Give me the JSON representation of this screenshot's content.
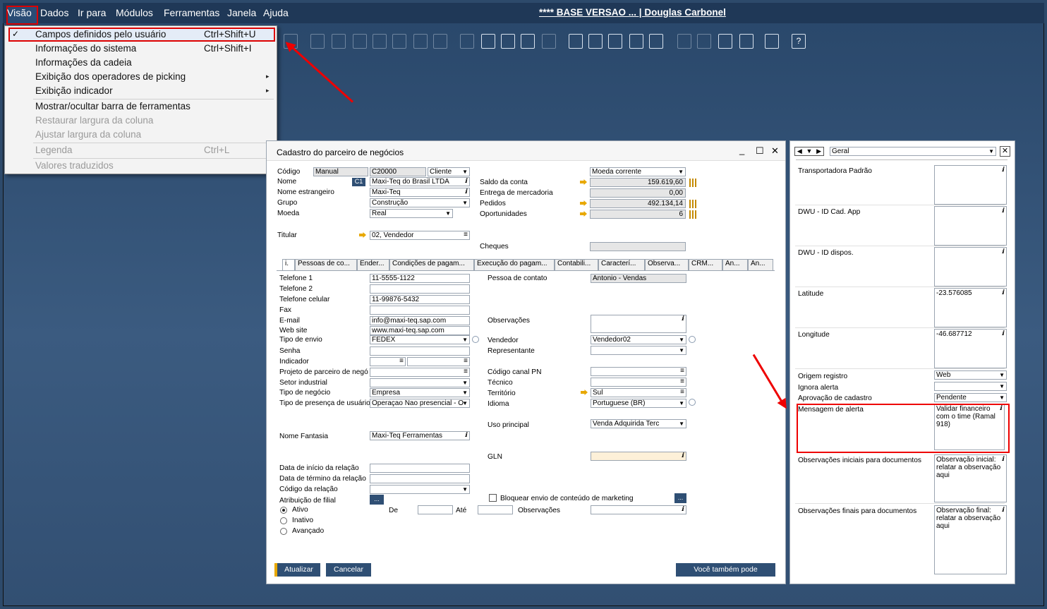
{
  "menubar": {
    "items": [
      "Visão",
      "Dados",
      "Ir para",
      "Módulos",
      "Ferramentas",
      "Janela",
      "Ajuda"
    ],
    "title": "**** BASE VERSAO ... | Douglas Carbonel"
  },
  "menu": {
    "items": [
      {
        "label": "Campos definidos pelo usuário",
        "shortcut": "Ctrl+Shift+U",
        "checked": true
      },
      {
        "label": "Informações do sistema",
        "shortcut": "Ctrl+Shift+I"
      },
      {
        "label": "Informações da cadeia",
        "shortcut": ""
      },
      {
        "label": "Exibição dos operadores de picking",
        "shortcut": ""
      },
      {
        "label": "Exibição indicador",
        "shortcut": ""
      },
      {
        "label": "Mostrar/ocultar barra de ferramentas",
        "shortcut": ""
      },
      {
        "label": "Restaurar largura da coluna",
        "shortcut": ""
      },
      {
        "label": "Ajustar largura da coluna",
        "shortcut": ""
      },
      {
        "label": "Legenda",
        "shortcut": "Ctrl+L"
      },
      {
        "label": "Valores traduzidos",
        "shortcut": ""
      }
    ],
    "checkmark": "✓",
    "submenu_arrow": "▸"
  },
  "form": {
    "title": "Cadastro do parceiro de negócios",
    "window_buttons": [
      "_",
      "☐",
      "✕"
    ],
    "header": {
      "codigo_label": "Código",
      "codigo_series": "Manual",
      "codigo_value": "C20000",
      "tipo": "Cliente",
      "nome_label": "Nome",
      "nome_badge": "C1",
      "nome_value": "Maxi-Teq do Brasil LTDA",
      "nome_estrangeiro_label": "Nome estrangeiro",
      "nome_estrangeiro_value": "Maxi-Teq",
      "grupo_label": "Grupo",
      "grupo_value": "Construção",
      "moeda_label": "Moeda",
      "moeda_value": "Real",
      "titular_label": "Titular",
      "titular_value": "02, Vendedor",
      "moeda_corrente": "Moeda corrente",
      "saldo_label": "Saldo da conta",
      "saldo_value": "159.619,60",
      "entrega_label": "Entrega de mercadoria",
      "entrega_value": "0,00",
      "pedidos_label": "Pedidos",
      "pedidos_value": "492.134,14",
      "oportunidades_label": "Oportunidades",
      "oportunidades_value": "6",
      "cheques_label": "Cheques",
      "cheques_value": ""
    },
    "tabs": [
      "i.",
      "Pessoas de co...",
      "Ender...",
      "Condições de pagam...",
      "Execução do pagam...",
      "Contabili...",
      "Caracterí...",
      "Observa...",
      "CRM...",
      "An...",
      "An..."
    ],
    "geral": {
      "telefone1_label": "Telefone 1",
      "telefone1": "11-5555-1122",
      "telefone2_label": "Telefone 2",
      "telefone2": "",
      "celular_label": "Telefone celular",
      "celular": "11-99876-5432",
      "fax_label": "Fax",
      "fax": "",
      "email_label": "E-mail",
      "email": "info@maxi-teq.sap.com",
      "web_label": "Web site",
      "web": "www.maxi-teq.sap.com",
      "envio_label": "Tipo de envio",
      "envio": "FEDEX",
      "senha_label": "Senha",
      "senha": "",
      "indicador_label": "Indicador",
      "projeto_label": "Projeto de parceiro de negó",
      "setor_label": "Setor industrial",
      "negocio_label": "Tipo de negócio",
      "negocio": "Empresa",
      "presenca_label": "Tipo de presença de usuário",
      "presenca": "Operaçao Nao presencial - O",
      "fantasia_label": "Nome Fantasia",
      "fantasia": "Maxi-Teq Ferramentas",
      "inicio_label": "Data de início da relação",
      "termino_label": "Data de término da relação",
      "codigo_relacao_label": "Código da relação",
      "filial_label": "Atribuição de filial",
      "contato_label": "Pessoa de contato",
      "contato": "Antonio - Vendas",
      "observacoes_label": "Observações",
      "vendedor_label": "Vendedor",
      "vendedor": "Vendedor02",
      "representante_label": "Representante",
      "canal_label": "Código canal PN",
      "tecnico_label": "Técnico",
      "territorio_label": "Território",
      "territorio": "Sul",
      "idioma_label": "Idioma",
      "idioma": "Portuguese (BR)",
      "uso_label": "Uso principal",
      "uso": "Venda Adquirida Terc",
      "gln_label": "GLN",
      "marketing_label": "Bloquear envio de conteúdo de marketing",
      "ativo": "Ativo",
      "inativo": "Inativo",
      "avancado": "Avançado",
      "de": "De",
      "ate": "Até",
      "obs2": "Observações"
    },
    "buttons": {
      "atualizar": "Atualizar",
      "cancelar": "Cancelar",
      "voce": "Você também pode"
    }
  },
  "side": {
    "nav": [
      "◀",
      "▼",
      "▶"
    ],
    "category": "Geral",
    "fields": [
      {
        "label": "Transportadora Padrão",
        "value": ""
      },
      {
        "label": "DWU - ID Cad. App",
        "value": ""
      },
      {
        "label": "DWU - ID dispos.",
        "value": ""
      },
      {
        "label": "Latitude",
        "value": "-23.576085"
      },
      {
        "label": "Longitude",
        "value": "-46.687712"
      },
      {
        "label": "Origem registro",
        "value": "Web"
      },
      {
        "label": "Ignora alerta",
        "value": ""
      },
      {
        "label": "Aprovação de cadastro",
        "value": "Pendente"
      },
      {
        "label": "Mensagem de alerta",
        "value": "Validar financeiro com o time (Ramal 918)"
      },
      {
        "label": "Observações iniciais para documentos",
        "value": "Observação inicial: relatar a observação aqui"
      },
      {
        "label": "Observações finais para documentos",
        "value": "Observação final: relatar a observação aqui"
      }
    ]
  },
  "colors": {
    "menubar": "#1f3857",
    "desktop": "#2f4f74",
    "button": "#2f4f74",
    "highlight": "#e00000"
  }
}
